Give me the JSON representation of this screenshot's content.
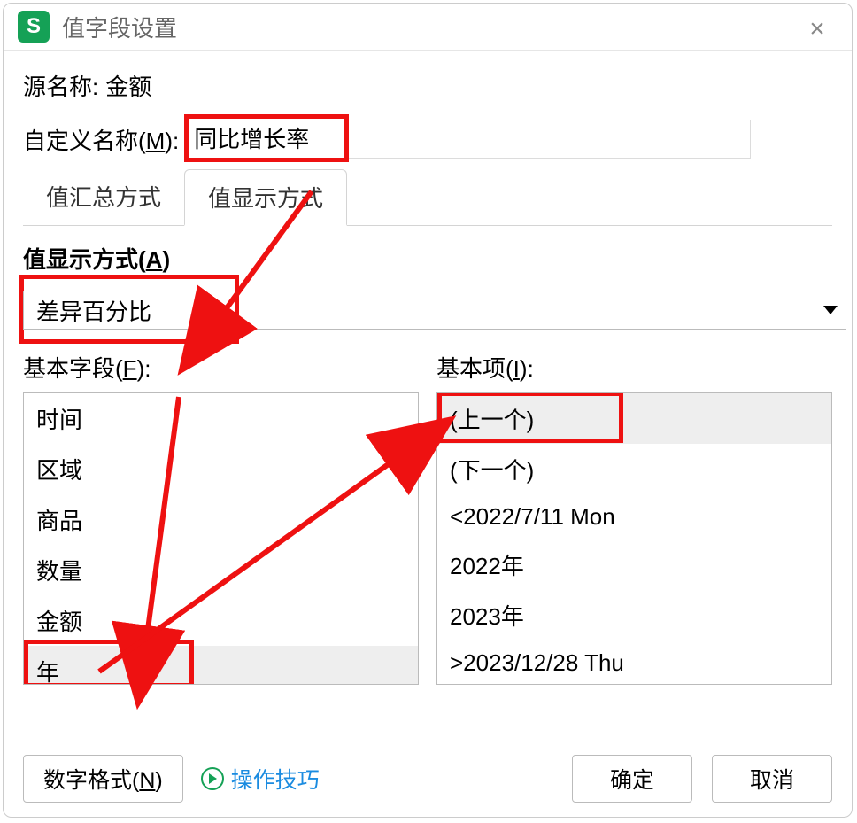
{
  "title": "值字段设置",
  "close": "×",
  "source_label": "源名称:",
  "source_value": "金额",
  "custom_label_pre": "自定义名称(",
  "custom_label_key": "M",
  "custom_label_post": "):",
  "custom_value": "同比增长率",
  "tabs": {
    "summary": "值汇总方式",
    "display": "值显示方式"
  },
  "display_label_pre": "值显示方式(",
  "display_label_key": "A",
  "display_label_post": ")",
  "display_value": "差异百分比",
  "base_field_label_pre": "基本字段(",
  "base_field_label_key": "F",
  "base_field_label_post": "):",
  "base_item_label_pre": "基本项(",
  "base_item_label_key": "I",
  "base_item_label_post": "):",
  "base_fields": [
    "时间",
    "区域",
    "商品",
    "数量",
    "金额",
    "年"
  ],
  "base_items": [
    "(上一个)",
    "(下一个)",
    "<2022/7/11 Mon",
    "2022年",
    "2023年",
    ">2023/12/28 Thu"
  ],
  "selected_field_index": 5,
  "selected_item_index": 0,
  "number_format_pre": "数字格式(",
  "number_format_key": "N",
  "number_format_post": ")",
  "tips": "操作技巧",
  "ok": "确定",
  "cancel": "取消"
}
